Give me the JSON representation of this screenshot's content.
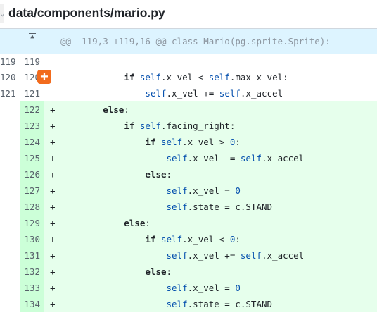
{
  "file": {
    "path": "data/components/mario.py",
    "collapse_glyph": "⌄"
  },
  "hunk": {
    "header": "@@ -119,3 +119,16 @@ class Mario(pg.sprite.Sprite):",
    "expand_glyph": "▲"
  },
  "add_comment": {
    "glyph": "+"
  },
  "lines": [
    {
      "type": "ctx",
      "old": "119",
      "new": "119",
      "marker": "",
      "segments": []
    },
    {
      "type": "ctx",
      "old": "120",
      "new": "120",
      "marker": "",
      "segments": [
        {
          "t": "            ",
          "c": ""
        },
        {
          "t": "if",
          "c": "kw"
        },
        {
          "t": " ",
          "c": ""
        },
        {
          "t": "self",
          "c": "self"
        },
        {
          "t": ".x_vel < ",
          "c": ""
        },
        {
          "t": "self",
          "c": "self"
        },
        {
          "t": ".max_x_vel:",
          "c": ""
        }
      ]
    },
    {
      "type": "ctx",
      "old": "121",
      "new": "121",
      "marker": "",
      "segments": [
        {
          "t": "                ",
          "c": ""
        },
        {
          "t": "self",
          "c": "self"
        },
        {
          "t": ".x_vel += ",
          "c": ""
        },
        {
          "t": "self",
          "c": "self"
        },
        {
          "t": ".x_accel",
          "c": ""
        }
      ]
    },
    {
      "type": "add",
      "old": "",
      "new": "122",
      "marker": "+",
      "segments": [
        {
          "t": "        ",
          "c": ""
        },
        {
          "t": "else",
          "c": "kw"
        },
        {
          "t": ":",
          "c": ""
        }
      ]
    },
    {
      "type": "add",
      "old": "",
      "new": "123",
      "marker": "+",
      "segments": [
        {
          "t": "            ",
          "c": ""
        },
        {
          "t": "if",
          "c": "kw"
        },
        {
          "t": " ",
          "c": ""
        },
        {
          "t": "self",
          "c": "self"
        },
        {
          "t": ".facing_right:",
          "c": ""
        }
      ]
    },
    {
      "type": "add",
      "old": "",
      "new": "124",
      "marker": "+",
      "segments": [
        {
          "t": "                ",
          "c": ""
        },
        {
          "t": "if",
          "c": "kw"
        },
        {
          "t": " ",
          "c": ""
        },
        {
          "t": "self",
          "c": "self"
        },
        {
          "t": ".x_vel > ",
          "c": ""
        },
        {
          "t": "0",
          "c": "numlit"
        },
        {
          "t": ":",
          "c": ""
        }
      ]
    },
    {
      "type": "add",
      "old": "",
      "new": "125",
      "marker": "+",
      "segments": [
        {
          "t": "                    ",
          "c": ""
        },
        {
          "t": "self",
          "c": "self"
        },
        {
          "t": ".x_vel -= ",
          "c": ""
        },
        {
          "t": "self",
          "c": "self"
        },
        {
          "t": ".x_accel",
          "c": ""
        }
      ]
    },
    {
      "type": "add",
      "old": "",
      "new": "126",
      "marker": "+",
      "segments": [
        {
          "t": "                ",
          "c": ""
        },
        {
          "t": "else",
          "c": "kw"
        },
        {
          "t": ":",
          "c": ""
        }
      ]
    },
    {
      "type": "add",
      "old": "",
      "new": "127",
      "marker": "+",
      "segments": [
        {
          "t": "                    ",
          "c": ""
        },
        {
          "t": "self",
          "c": "self"
        },
        {
          "t": ".x_vel = ",
          "c": ""
        },
        {
          "t": "0",
          "c": "numlit"
        }
      ]
    },
    {
      "type": "add",
      "old": "",
      "new": "128",
      "marker": "+",
      "segments": [
        {
          "t": "                    ",
          "c": ""
        },
        {
          "t": "self",
          "c": "self"
        },
        {
          "t": ".state = c.STAND",
          "c": ""
        }
      ]
    },
    {
      "type": "add",
      "old": "",
      "new": "129",
      "marker": "+",
      "segments": [
        {
          "t": "            ",
          "c": ""
        },
        {
          "t": "else",
          "c": "kw"
        },
        {
          "t": ":",
          "c": ""
        }
      ]
    },
    {
      "type": "add",
      "old": "",
      "new": "130",
      "marker": "+",
      "segments": [
        {
          "t": "                ",
          "c": ""
        },
        {
          "t": "if",
          "c": "kw"
        },
        {
          "t": " ",
          "c": ""
        },
        {
          "t": "self",
          "c": "self"
        },
        {
          "t": ".x_vel < ",
          "c": ""
        },
        {
          "t": "0",
          "c": "numlit"
        },
        {
          "t": ":",
          "c": ""
        }
      ]
    },
    {
      "type": "add",
      "old": "",
      "new": "131",
      "marker": "+",
      "segments": [
        {
          "t": "                    ",
          "c": ""
        },
        {
          "t": "self",
          "c": "self"
        },
        {
          "t": ".x_vel += ",
          "c": ""
        },
        {
          "t": "self",
          "c": "self"
        },
        {
          "t": ".x_accel",
          "c": ""
        }
      ]
    },
    {
      "type": "add",
      "old": "",
      "new": "132",
      "marker": "+",
      "segments": [
        {
          "t": "                ",
          "c": ""
        },
        {
          "t": "else",
          "c": "kw"
        },
        {
          "t": ":",
          "c": ""
        }
      ]
    },
    {
      "type": "add",
      "old": "",
      "new": "133",
      "marker": "+",
      "segments": [
        {
          "t": "                    ",
          "c": ""
        },
        {
          "t": "self",
          "c": "self"
        },
        {
          "t": ".x_vel = ",
          "c": ""
        },
        {
          "t": "0",
          "c": "numlit"
        }
      ]
    },
    {
      "type": "add",
      "old": "",
      "new": "134",
      "marker": "+",
      "segments": [
        {
          "t": "                    ",
          "c": ""
        },
        {
          "t": "self",
          "c": "self"
        },
        {
          "t": ".state = c.STAND",
          "c": ""
        }
      ]
    }
  ],
  "colors": {
    "hunk_bg": "#ddf4ff",
    "add_line_bg": "#e6ffec",
    "add_num_bg": "#ccffd8",
    "comment_button": "#f26b1d"
  }
}
